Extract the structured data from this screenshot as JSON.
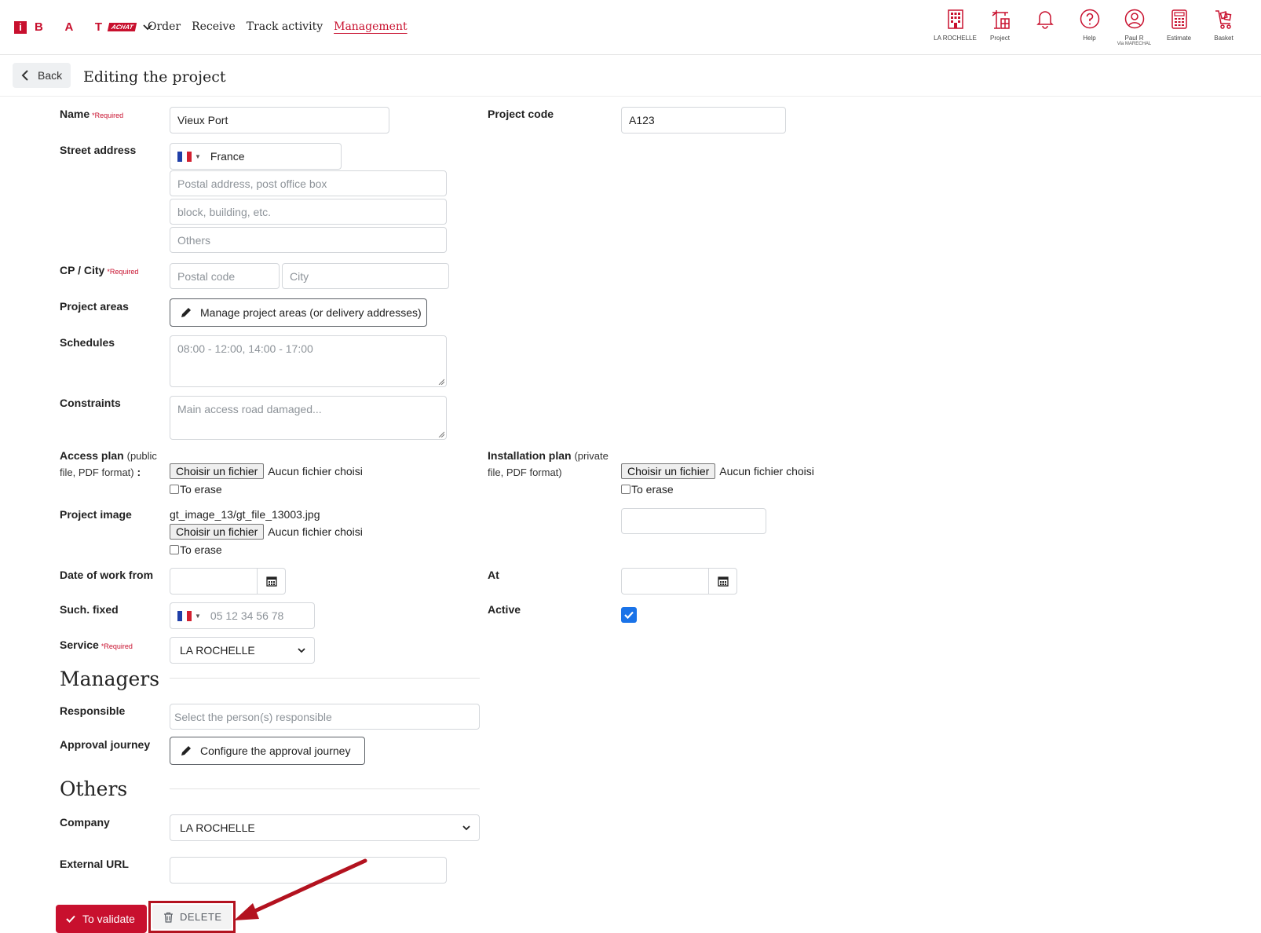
{
  "app": {
    "logo_letters": "B A T",
    "logo_i": "i",
    "logo_badge": "ACHAT",
    "nav": [
      "Order",
      "Receive",
      "Track activity",
      "Management"
    ],
    "active_nav": "Management",
    "top_icons": [
      {
        "label": "LA ROCHELLE",
        "icon": "building-icon"
      },
      {
        "label": "Project",
        "icon": "crane-icon"
      },
      {
        "label": "",
        "icon": "bell-icon"
      },
      {
        "label": "Help",
        "icon": "help-icon"
      },
      {
        "label": "Paul R",
        "sub": "Via MARECHAL",
        "icon": "user-icon"
      },
      {
        "label": "Estimate",
        "icon": "calculator-icon"
      },
      {
        "label": "Basket",
        "icon": "basket-icon"
      }
    ],
    "accent_color": "#c8102e"
  },
  "header": {
    "back_label": "Back",
    "title": "Editing the project"
  },
  "form": {
    "required_tag": "*Required",
    "name": {
      "label": "Name",
      "value": "Vieux Port"
    },
    "project_code": {
      "label": "Project code",
      "value": "A123"
    },
    "street": {
      "label": "Street address",
      "country": "France",
      "line1_placeholder": "Postal address, post office box",
      "line2_placeholder": "block, building, etc.",
      "line3_placeholder": "Others"
    },
    "cp_city": {
      "label": "CP / City",
      "postal_placeholder": "Postal code",
      "city_placeholder": "City"
    },
    "project_areas": {
      "label": "Project areas",
      "button": "Manage project areas (or delivery addresses)"
    },
    "schedules": {
      "label": "Schedules",
      "placeholder": "08:00 - 12:00, 14:00 - 17:00"
    },
    "constraints": {
      "label": "Constraints",
      "placeholder": "Main access road damaged..."
    },
    "access_plan": {
      "label": "Access plan",
      "note1": "(public",
      "note2": "file, PDF format)",
      "colon": " :"
    },
    "installation_plan": {
      "label": "Installation plan",
      "note1": "(private",
      "note2": "file, PDF format)"
    },
    "file_button": "Choisir un fichier",
    "file_none": "Aucun fichier choisi",
    "erase_label": "To erase",
    "project_image": {
      "label": "Project image",
      "current_file": "gt_image_13/gt_file_13003.jpg"
    },
    "date_from": {
      "label": "Date of work from"
    },
    "date_to": {
      "label": "At"
    },
    "phone": {
      "label": "Such. fixed",
      "placeholder": "05 12 34 56 78"
    },
    "active": {
      "label": "Active",
      "checked": true
    },
    "service": {
      "label": "Service",
      "value": "LA ROCHELLE"
    }
  },
  "managers": {
    "title": "Managers",
    "responsible": {
      "label": "Responsible",
      "placeholder": "Select the person(s) responsible"
    },
    "approval": {
      "label": "Approval journey",
      "button": "Configure the approval journey"
    }
  },
  "others": {
    "title": "Others",
    "company": {
      "label": "Company",
      "value": "LA ROCHELLE"
    },
    "external_url": {
      "label": "External URL",
      "value": ""
    }
  },
  "actions": {
    "validate": "To validate",
    "delete": "DELETE"
  }
}
